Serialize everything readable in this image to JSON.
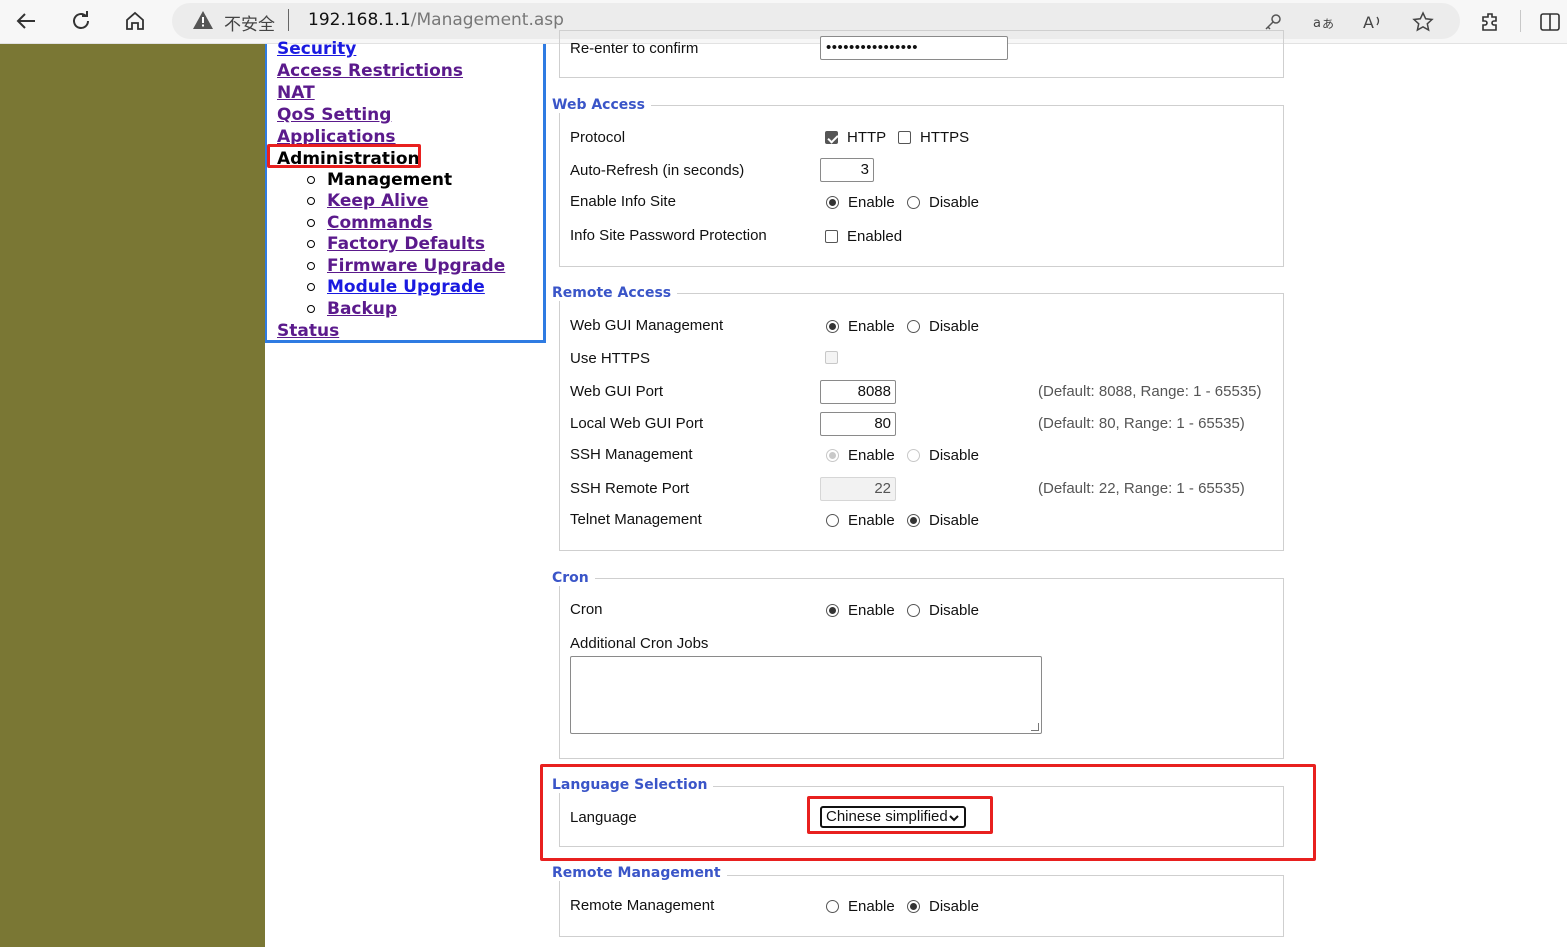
{
  "browser": {
    "insecure_label": "不安全",
    "url_host": "192.168.1.1",
    "url_path": "/Management.asp"
  },
  "menu": {
    "security": "Security",
    "access_restrictions": "Access Restrictions",
    "nat": "NAT",
    "qos": "QoS Setting",
    "applications": "Applications",
    "administration": "Administration",
    "status": "Status",
    "sub": {
      "management": "Management",
      "keep_alive": "Keep Alive",
      "commands": "Commands",
      "factory_defaults": "Factory Defaults",
      "firmware_upgrade": "Firmware Upgrade",
      "module_upgrade": "Module Upgrade",
      "backup": "Backup"
    }
  },
  "router_password": {
    "reenter_label": "Re-enter to confirm",
    "reenter_value": "••••••••••••••••"
  },
  "web_access": {
    "legend": "Web Access",
    "protocol_label": "Protocol",
    "http_label": "HTTP",
    "https_label": "HTTPS",
    "autorefresh_label": "Auto-Refresh (in seconds)",
    "autorefresh_value": "3",
    "info_site_label": "Enable Info Site",
    "info_pw_label": "Info Site Password Protection",
    "enabled_label": "Enabled"
  },
  "remote_access": {
    "legend": "Remote Access",
    "webgui_label": "Web GUI Management",
    "use_https_label": "Use HTTPS",
    "webgui_port_label": "Web GUI Port",
    "webgui_port_value": "8088",
    "webgui_port_hint": "(Default: 8088, Range: 1 - 65535)",
    "local_port_label": "Local Web GUI Port",
    "local_port_value": "80",
    "local_port_hint": "(Default: 80, Range: 1 - 65535)",
    "ssh_label": "SSH Management",
    "ssh_port_label": "SSH Remote Port",
    "ssh_port_value": "22",
    "ssh_port_hint": "(Default: 22, Range: 1 - 65535)",
    "telnet_label": "Telnet Management"
  },
  "cron": {
    "legend": "Cron",
    "cron_label": "Cron",
    "jobs_label": "Additional Cron Jobs"
  },
  "language": {
    "legend": "Language Selection",
    "label": "Language",
    "selected": "Chinese simplified"
  },
  "remote_management": {
    "legend": "Remote Management",
    "label": "Remote Management"
  },
  "common": {
    "enable": "Enable",
    "disable": "Disable"
  },
  "colors": {
    "olive": "#7a7734",
    "menu_border": "#2f7be2",
    "legend": "#3a55c8",
    "highlight": "#e8201f"
  }
}
